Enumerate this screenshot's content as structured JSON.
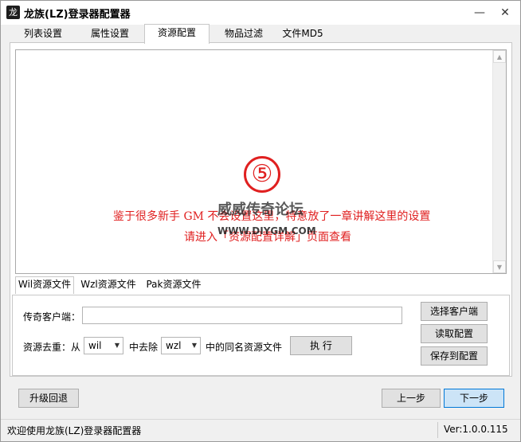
{
  "window": {
    "title": "龙族(LZ)登录器配置器",
    "minimize_glyph": "—",
    "close_glyph": "✕",
    "app_icon_glyph": "龙"
  },
  "tabs": [
    {
      "label": "列表设置"
    },
    {
      "label": "属性设置"
    },
    {
      "label": "资源配置",
      "active": true
    },
    {
      "label": "物品过滤"
    },
    {
      "label": "文件MD5"
    }
  ],
  "resource_page": {
    "notice": {
      "number": "⑤",
      "line1": "鉴于很多新手 GM 不会设置这里，特意放了一章讲解这里的设置",
      "line2": "请进入「资源配置详解」页面查看",
      "watermark": "威威传奇论坛",
      "watermark_url": "WWW.DIYGM.COM",
      "color": "#e02020"
    },
    "subtabs": [
      {
        "label": "Wil资源文件",
        "active": true
      },
      {
        "label": "Wzl资源文件"
      },
      {
        "label": "Pak资源文件"
      }
    ],
    "client_label": "传奇客户端：",
    "client_value": "",
    "dedupe_label": "资源去重：从",
    "from_select": "wil",
    "middle_label": "中去除",
    "remove_select": "wzl",
    "suffix_label": "中的同名资源文件",
    "execute_button": "执  行",
    "select_client_button": "选择客户端",
    "read_config_button": "读取配置",
    "save_config_button": "保存到配置"
  },
  "footer_buttons": {
    "upgrade_rollback": "升级回退",
    "prev": "上一步",
    "next": "下一步"
  },
  "statusbar": {
    "welcome": "欢迎使用龙族(LZ)登录器配置器",
    "version": "Ver:1.0.0.115"
  },
  "colors": {
    "accent_primary_button": "#cce4f7",
    "accent_border": "#0078d7"
  }
}
